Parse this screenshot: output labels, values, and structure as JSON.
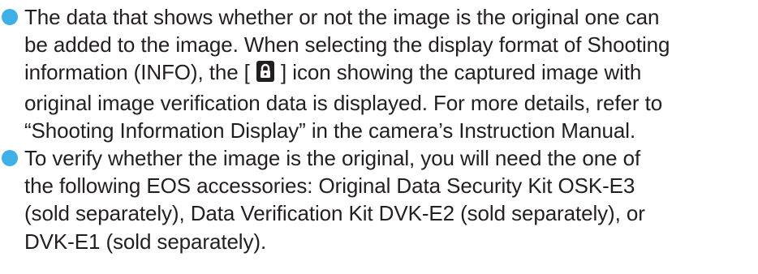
{
  "colors": {
    "bullet": "#3fb0e6",
    "text": "#231f20"
  },
  "items": [
    {
      "lines": [
        "The data that shows whether or not the image is the original one can",
        "be added to the image. When selecting the display format of Shooting"
      ],
      "icon_line_before": "information (INFO), the [ ",
      "icon": "lock-icon",
      "icon_line_after": " ] icon showing the captured image with",
      "lines_after": [
        "original image verification data is displayed. For more details, refer to",
        "“Shooting Information Display” in the camera’s Instruction Manual."
      ]
    },
    {
      "lines": [
        "To verify whether the image is the original, you will need the one of",
        "the following EOS accessories: Original Data Security Kit OSK-E3",
        "(sold separately), Data Verification Kit DVK-E2 (sold separately), or",
        "DVK-E1 (sold separately)."
      ]
    }
  ]
}
